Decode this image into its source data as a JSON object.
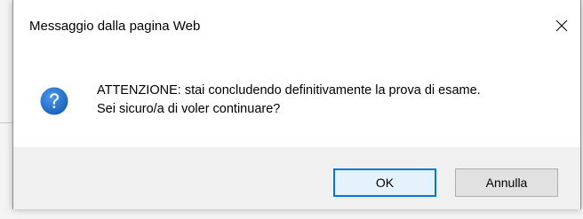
{
  "dialog": {
    "title": "Messaggio dalla pagina Web",
    "message_line1": "ATTENZIONE: stai concludendo definitivamente la prova di esame.",
    "message_line2": "Sei sicuro/a di voler continuare?",
    "icon": "question-icon",
    "icon_color": "#1e6fd0",
    "buttons": {
      "ok_label": "OK",
      "cancel_label": "Annulla"
    },
    "default_button": "OK",
    "accent_color": "#0078d7"
  }
}
